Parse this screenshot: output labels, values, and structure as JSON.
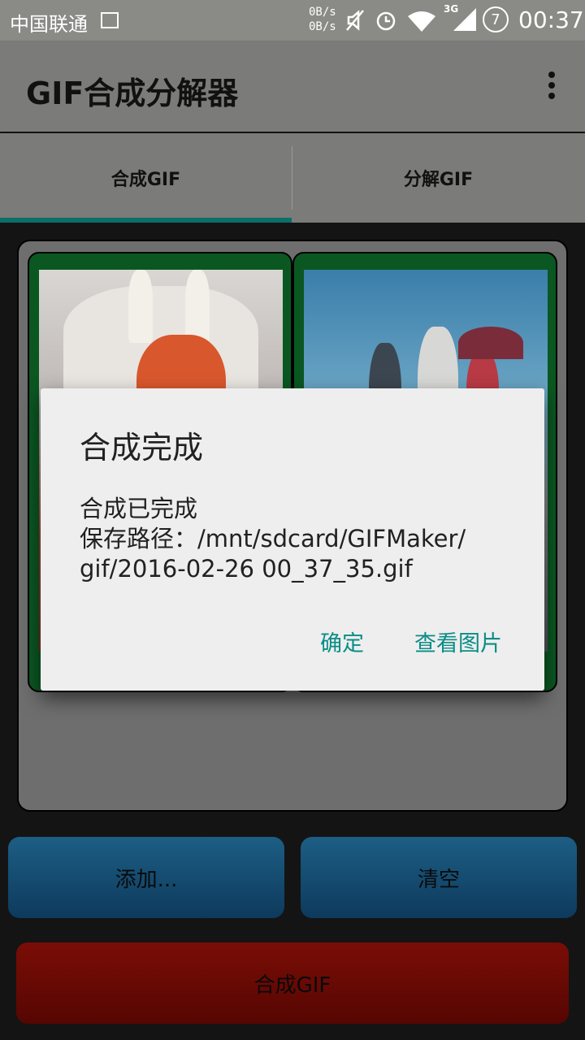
{
  "status_bar": {
    "carrier": "中国联通",
    "net_speed_up": "0B/s",
    "net_speed_down": "0B/s",
    "network_type": "3G",
    "battery_level": "7",
    "time": "00:37",
    "icons": [
      "image-icon",
      "mute-icon",
      "alarm-icon",
      "wifi-icon",
      "signal-icon",
      "battery-icon"
    ]
  },
  "app_bar": {
    "title": "GIF合成分解器"
  },
  "tabs": {
    "items": [
      {
        "label": "合成GIF",
        "selected": true
      },
      {
        "label": "分解GIF",
        "selected": false
      }
    ],
    "indicator_color": "#0b6f6a"
  },
  "actions": {
    "add_label": "添加...",
    "clear_label": "清空",
    "make_label": "合成GIF"
  },
  "dialog": {
    "title": "合成完成",
    "message": "合成已完成\n保存路径：/mnt/sdcard/GIFMaker/\ngif/2016-02-26 00_37_35.gif",
    "ok_label": "确定",
    "view_label": "查看图片",
    "accent_color": "#0a8d86"
  }
}
